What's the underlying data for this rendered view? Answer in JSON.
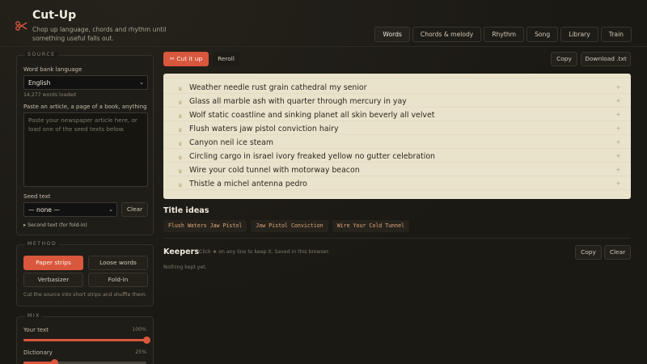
{
  "app": {
    "title": "Cut-Up",
    "subtitle": "Chop up language, chords and rhythm until something useful falls out."
  },
  "tabs": [
    {
      "label": "Words",
      "active": true
    },
    {
      "label": "Chords & melody",
      "active": false
    },
    {
      "label": "Rhythm",
      "active": false
    },
    {
      "label": "Song",
      "active": false
    },
    {
      "label": "Library",
      "active": false
    },
    {
      "label": "Train",
      "active": false
    }
  ],
  "source": {
    "legend": "SOURCE",
    "word_bank_label": "Word bank language",
    "word_bank_value": "English",
    "words_loaded": "14,277 words loaded",
    "paste_label": "Paste an article, a page of a book, anything",
    "paste_placeholder": "Paste your newspaper article here, or load one of the seed texts below.",
    "seed_label": "Seed text",
    "seed_value": "— none —",
    "clear_label": "Clear",
    "second_text": "▸ Second text (for fold-in)"
  },
  "method": {
    "legend": "METHOD",
    "options": [
      {
        "label": "Paper strips",
        "active": true
      },
      {
        "label": "Loose words",
        "active": false
      },
      {
        "label": "Verbasizer",
        "active": false
      },
      {
        "label": "Fold-in",
        "active": false
      }
    ],
    "description": "Cut the source into short strips and shuffle them."
  },
  "mix": {
    "legend": "MIX",
    "sliders": [
      {
        "label": "Your text",
        "value_text": "100%",
        "value": 1.0
      },
      {
        "label": "Dictionary",
        "value_text": "25%",
        "value": 0.25
      }
    ]
  },
  "toolbar": {
    "cut_label": "✂ Cut it up",
    "reroll_label": "Reroll",
    "copy_label": "Copy",
    "download_label": "Download .txt"
  },
  "output": {
    "bullet": "♛",
    "plus": "+",
    "lines": [
      "Weather needle rust grain cathedral my senior",
      "Glass all marble ash with quarter through mercury in yay",
      "Wolf static coastline and sinking planet all skin beverly all velvet",
      "Flush waters jaw pistol conviction hairy",
      "Canyon neil ice steam",
      "Circling cargo in israel ivory freaked yellow no gutter celebration",
      "Wire your cold tunnel with motorway beacon",
      "Thistle a michel antenna pedro"
    ]
  },
  "title_ideas": {
    "heading": "Title ideas",
    "chips": [
      "Flush Waters Jaw Pistol",
      "Jaw Pistol Conviction",
      "Wire Your Cold Tunnel"
    ]
  },
  "keepers": {
    "heading": "Keepers",
    "hint": "Click ★ on any line to keep it. Saved in this browser.",
    "empty": "Nothing kept yet.",
    "copy_label": "Copy",
    "clear_label": "Clear"
  },
  "colors": {
    "accent": "#d9573d",
    "paper": "#eae3cc",
    "background": "#1b1914"
  }
}
